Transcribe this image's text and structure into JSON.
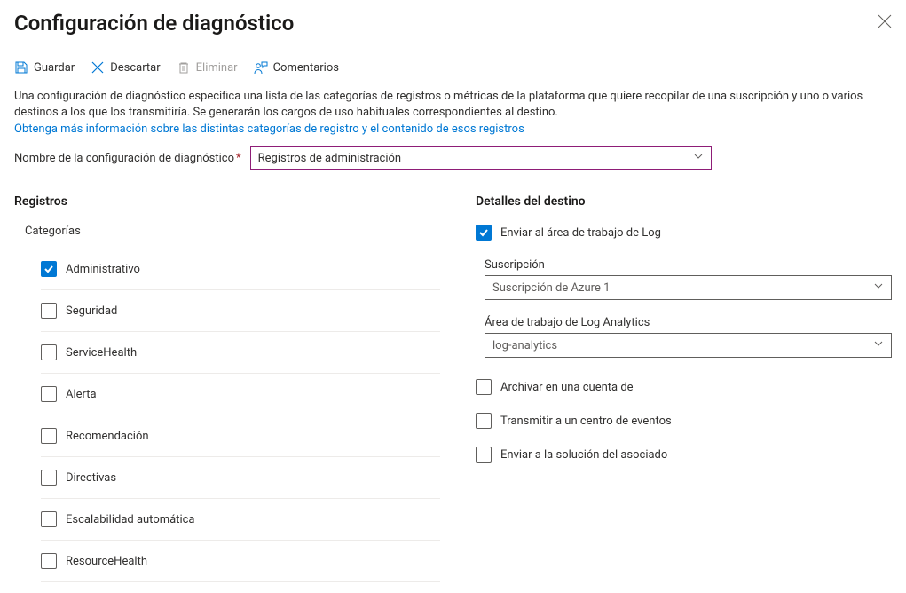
{
  "page_title": "Configuración de diagnóstico",
  "toolbar": {
    "save": "Guardar",
    "discard": "Descartar",
    "delete": "Eliminar",
    "feedback": "Comentarios"
  },
  "description": "Una configuración de diagnóstico especifica una lista de las categorías de registros o métricas de la plataforma que quiere recopilar de una suscripción y uno o varios destinos a los que los transmitiría. Se generarán los cargos de uso habituales correspondientes al destino.",
  "learn_more": "Obtenga más información sobre las distintas categorías de registro y el contenido de esos registros",
  "name_label": "Nombre de la configuración de diagnóstico",
  "name_value": "Registros de administración",
  "logs": {
    "heading": "Registros",
    "sub_heading": "Categorías",
    "categories": [
      {
        "label": "Administrativo",
        "checked": true
      },
      {
        "label": "Seguridad",
        "checked": false
      },
      {
        "label": "ServiceHealth",
        "checked": false
      },
      {
        "label": "Alerta",
        "checked": false
      },
      {
        "label": "Recomendación",
        "checked": false
      },
      {
        "label": "Directivas",
        "checked": false
      },
      {
        "label": "Escalabilidad automática",
        "checked": false
      },
      {
        "label": "ResourceHealth",
        "checked": false
      }
    ]
  },
  "destination": {
    "heading": "Detalles del destino",
    "send_log_workspace": {
      "label": "Enviar al área de trabajo de Log",
      "checked": true
    },
    "subscription_label": "Suscripción",
    "subscription_value": "Suscripción de Azure 1",
    "workspace_label": "Área de trabajo de Log Analytics",
    "workspace_value": "log-analytics",
    "archive_storage": {
      "label": "Archivar en una cuenta de",
      "checked": false
    },
    "stream_eventhub": {
      "label": "Transmitir a un centro de eventos",
      "checked": false
    },
    "send_partner": {
      "label": "Enviar a la solución del asociado",
      "checked": false
    }
  }
}
